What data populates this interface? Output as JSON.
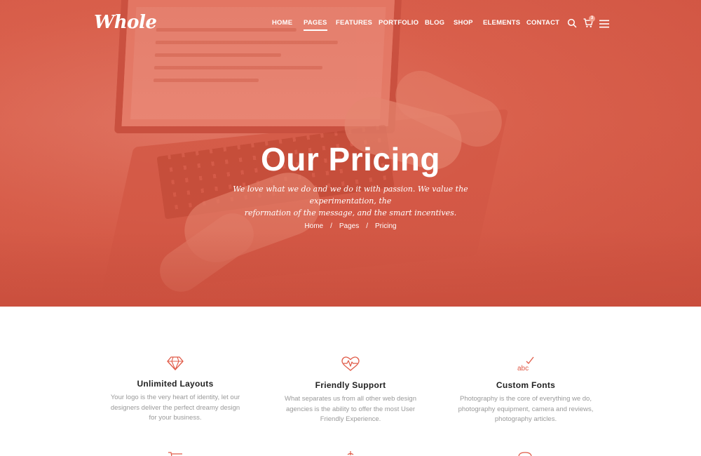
{
  "brand": {
    "logo_text": "Whole"
  },
  "nav": {
    "items": [
      {
        "label": "HOME",
        "active": false
      },
      {
        "label": "PAGES",
        "active": true
      },
      {
        "label": "FEATURES",
        "active": false
      },
      {
        "label": "PORTFOLIO",
        "active": false
      },
      {
        "label": "BLOG",
        "active": false
      },
      {
        "label": "SHOP",
        "active": false
      },
      {
        "label": "ELEMENTS",
        "active": false
      },
      {
        "label": "CONTACT",
        "active": false
      }
    ],
    "icons": [
      "search-icon",
      "cart-icon",
      "hamburger-menu-icon"
    ],
    "cart_count": "3"
  },
  "hero": {
    "title": "Our Pricing",
    "subtitle_line1": "We love what we do and we do it with passion. We value the experimentation, the",
    "subtitle_line2": "reformation of the message, and the smart incentives.",
    "breadcrumb": [
      "Home",
      "Pages",
      "Pricing"
    ],
    "breadcrumb_separator": "/"
  },
  "features": [
    {
      "icon": "diamond-icon",
      "title": "Unlimited Layouts",
      "desc": [
        "Your logo is the very heart of  identity, let our",
        "designers deliver the perfect dreamy design",
        "for your business."
      ]
    },
    {
      "icon": "heartbeat-icon",
      "title": "Friendly Support",
      "desc": [
        "What separates us from all other web design",
        "agencies is the ability to offer the most User",
        "Friendly Experience."
      ]
    },
    {
      "icon": "abc-check-icon",
      "title": "Custom Fonts",
      "desc": [
        "Photography is the core of everything we do,",
        "photography equipment, camera and reviews,",
        "photography articles."
      ]
    }
  ],
  "colors": {
    "accent": "#e05a47",
    "hero_overlay": "#d9604c",
    "title_text": "#222222",
    "body_text": "#999999"
  }
}
